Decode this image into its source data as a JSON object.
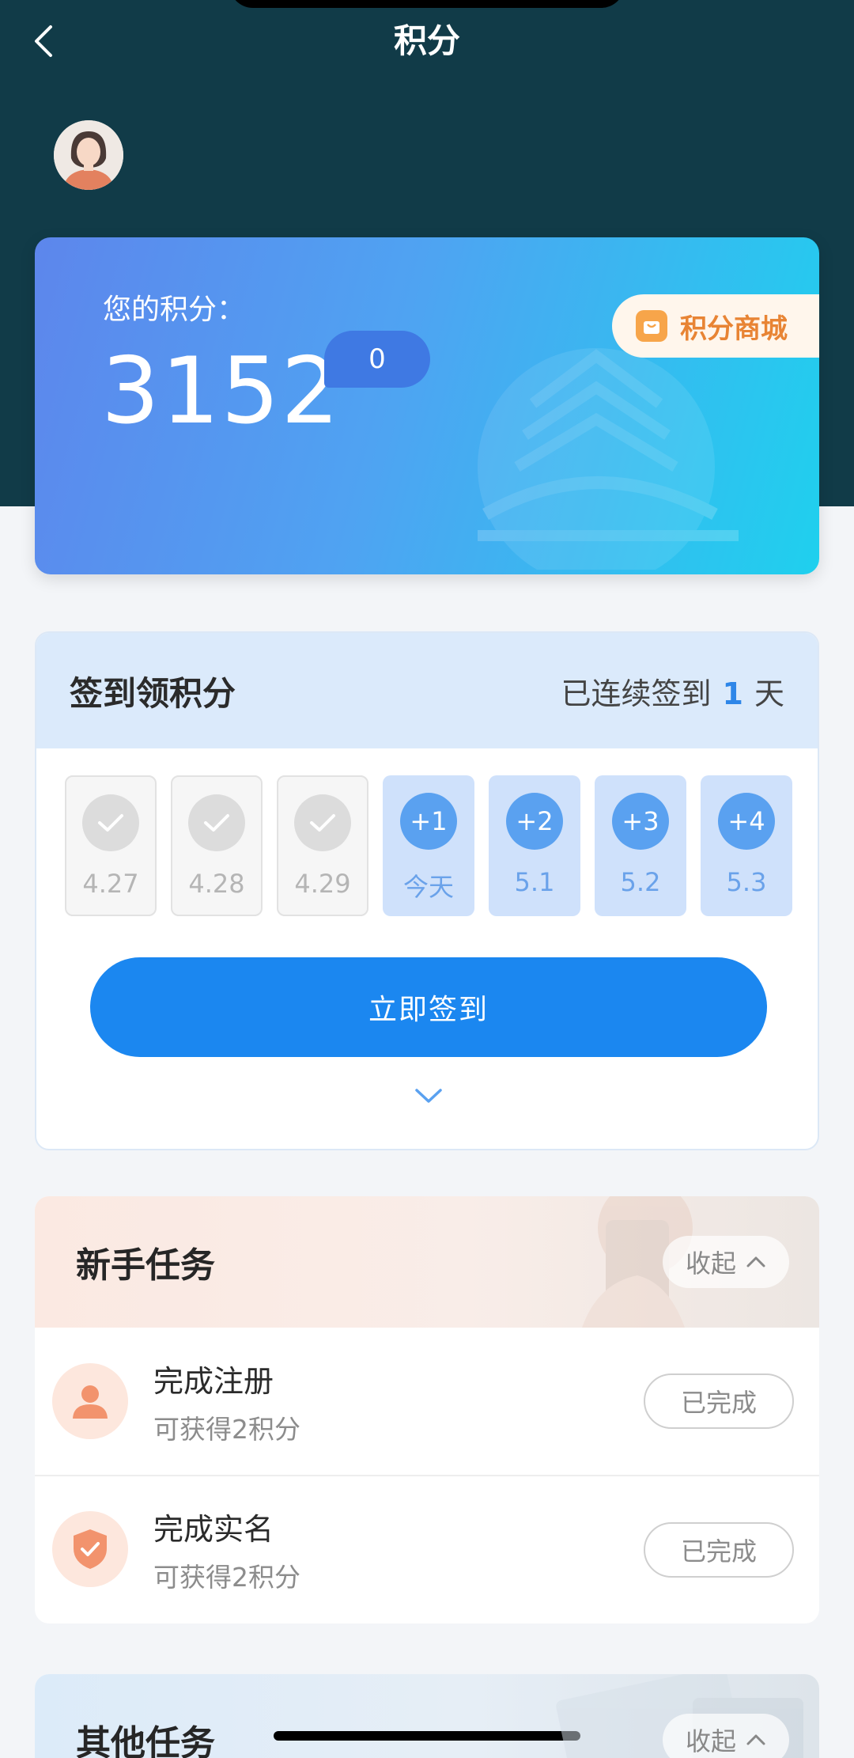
{
  "header": {
    "title": "积分"
  },
  "points": {
    "label": "您的积分：",
    "value": "3152",
    "bubble": "0",
    "mall_label": "积分商城"
  },
  "signin": {
    "title": "签到领积分",
    "streak_prefix": "已连续签到",
    "streak_days": "1",
    "streak_suffix": "天",
    "days": [
      {
        "date": "4.27",
        "done": true
      },
      {
        "date": "4.28",
        "done": true
      },
      {
        "date": "4.29",
        "done": true
      },
      {
        "reward": "+1",
        "date": "今天",
        "done": false
      },
      {
        "reward": "+2",
        "date": "5.1",
        "done": false
      },
      {
        "reward": "+3",
        "date": "5.2",
        "done": false
      },
      {
        "reward": "+4",
        "date": "5.3",
        "done": false
      }
    ],
    "button_label": "立即签到"
  },
  "newbie_tasks": {
    "title": "新手任务",
    "collapse_label": "收起",
    "items": [
      {
        "name": "完成注册",
        "reward": "可获得2积分",
        "status": "已完成",
        "icon": "user-icon"
      },
      {
        "name": "完成实名",
        "reward": "可获得2积分",
        "status": "已完成",
        "icon": "shield-check-icon"
      }
    ]
  },
  "other_tasks": {
    "title": "其他任务",
    "collapse_label": "收起"
  },
  "colors": {
    "header_bg": "#113b48",
    "primary_blue": "#1b87f0",
    "accent_orange": "#e88434"
  }
}
